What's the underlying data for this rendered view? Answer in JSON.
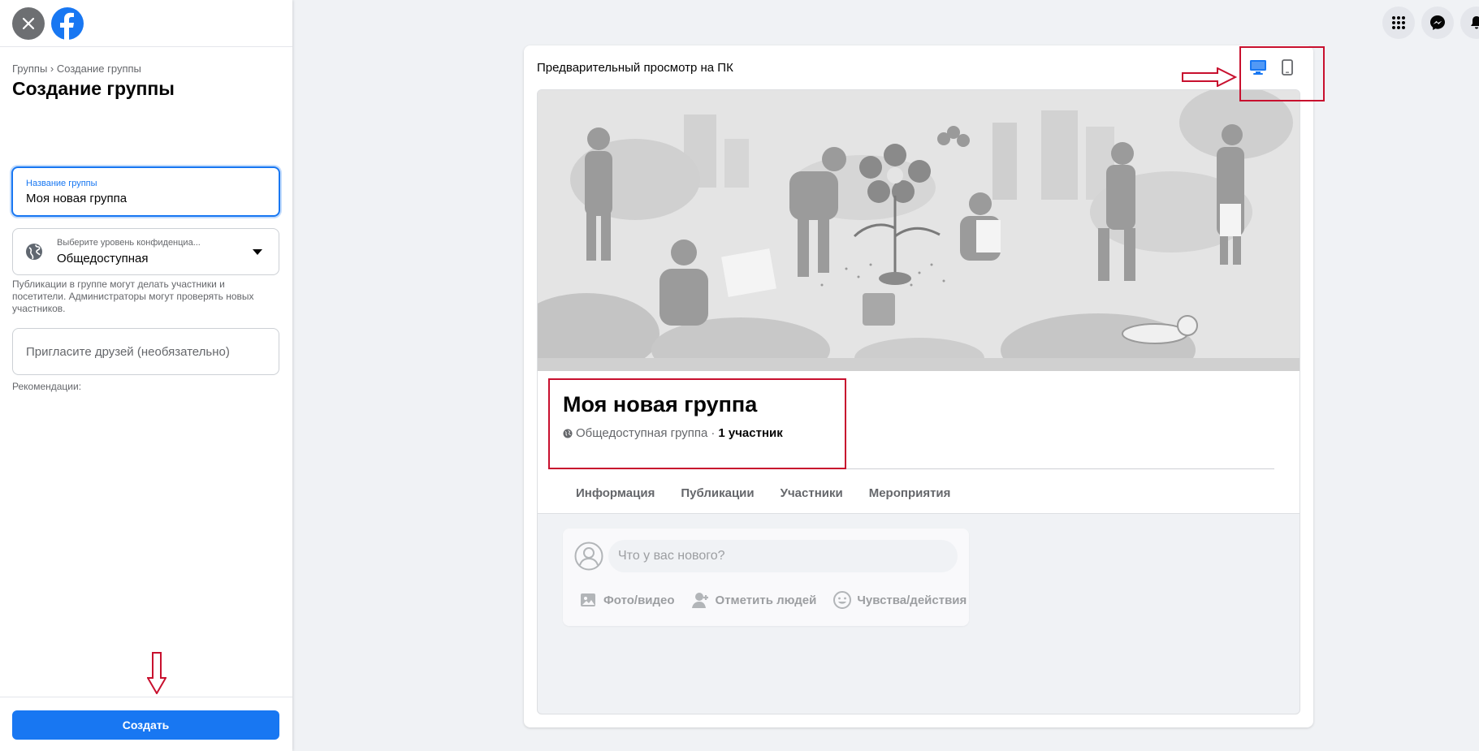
{
  "left_panel": {
    "breadcrumb": "Группы › Создание группы",
    "title": "Создание группы",
    "name_field": {
      "label": "Название группы",
      "value": "Моя новая группа"
    },
    "privacy": {
      "label": "Выберите уровень конфиденциа...",
      "value": "Общедоступная"
    },
    "privacy_note": "Публикации в группе могут делать участники и посетители. Администраторы могут проверять новых участников.",
    "invite_placeholder": "Пригласите друзей (необязательно)",
    "recommendations_label": "Рекомендации:",
    "create_button": "Создать"
  },
  "preview": {
    "title": "Предварительный просмотр на ПК",
    "group_name": "Моя новая группа",
    "privacy_text": "Общедоступная группа",
    "separator": "·",
    "member_count": "1 участник",
    "tabs": [
      "Информация",
      "Публикации",
      "Участники",
      "Мероприятия"
    ],
    "composer": {
      "placeholder": "Что у вас нового?",
      "actions": [
        "Фото/видео",
        "Отметить людей",
        "Чувства/действия"
      ]
    }
  },
  "colors": {
    "accent": "#1877f2",
    "annotation": "#c8102e",
    "background": "#f0f2f5"
  },
  "icons": [
    "close-icon",
    "facebook-logo-icon",
    "globe-icon",
    "chevron-down-icon",
    "desktop-icon",
    "mobile-icon",
    "menu-grid-icon",
    "messenger-icon",
    "bell-icon"
  ]
}
